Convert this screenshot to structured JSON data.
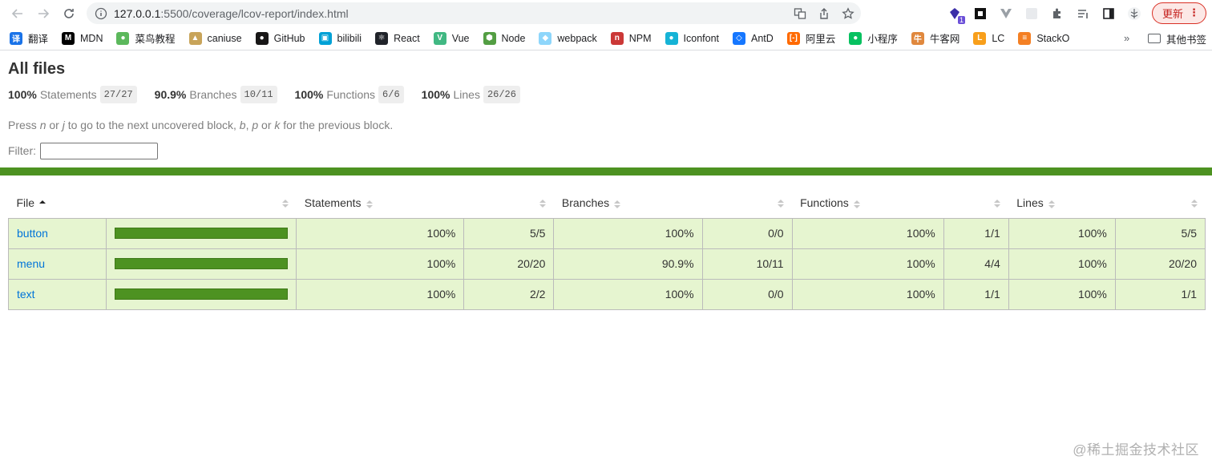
{
  "browser": {
    "url_host": "127.0.0.1",
    "url_rest": ":5500/coverage/lcov-report/index.html",
    "update_label": "更新",
    "extension_badge": "1",
    "bookmarks": [
      {
        "label": "翻译",
        "icon": "translate-icon",
        "color": "#1a73e8",
        "glyph": "译"
      },
      {
        "label": "MDN",
        "icon": "mdn-icon",
        "color": "#000000",
        "glyph": "M"
      },
      {
        "label": "菜鸟教程",
        "icon": "runoob-icon",
        "color": "#5cb85c",
        "glyph": "●"
      },
      {
        "label": "caniuse",
        "icon": "caniuse-icon",
        "color": "#c8a45a",
        "glyph": "▲"
      },
      {
        "label": "GitHub",
        "icon": "github-icon",
        "color": "#181717",
        "glyph": "●"
      },
      {
        "label": "bilibili",
        "icon": "bilibili-icon",
        "color": "#00a1d6",
        "glyph": "▣"
      },
      {
        "label": "React",
        "icon": "react-icon",
        "color": "#20232a",
        "glyph": "⚛"
      },
      {
        "label": "Vue",
        "icon": "vue-icon",
        "color": "#41b883",
        "glyph": "V"
      },
      {
        "label": "Node",
        "icon": "node-icon",
        "color": "#539e43",
        "glyph": "⬢"
      },
      {
        "label": "webpack",
        "icon": "webpack-icon",
        "color": "#8ed6fb",
        "glyph": "◆"
      },
      {
        "label": "NPM",
        "icon": "npm-icon",
        "color": "#cb3837",
        "glyph": "n"
      },
      {
        "label": "Iconfont",
        "icon": "iconfont-icon",
        "color": "#16b3d6",
        "glyph": "●"
      },
      {
        "label": "AntD",
        "icon": "antd-icon",
        "color": "#1677ff",
        "glyph": "◇"
      },
      {
        "label": "阿里云",
        "icon": "aliyun-icon",
        "color": "#ff6a00",
        "glyph": "[-]"
      },
      {
        "label": "小程序",
        "icon": "miniprogram-icon",
        "color": "#07c160",
        "glyph": "●"
      },
      {
        "label": "牛客网",
        "icon": "nowcoder-icon",
        "color": "#e0883e",
        "glyph": "牛"
      },
      {
        "label": "LC",
        "icon": "leetcode-icon",
        "color": "#f89f1b",
        "glyph": "L"
      },
      {
        "label": "StackO",
        "icon": "stackoverflow-icon",
        "color": "#f48024",
        "glyph": "≡"
      }
    ],
    "more_label": "»",
    "folder_label": "其他书签"
  },
  "report": {
    "title": "All files",
    "summary": [
      {
        "pct": "100%",
        "label": "Statements",
        "fraction": "27/27"
      },
      {
        "pct": "90.9%",
        "label": "Branches",
        "fraction": "10/11"
      },
      {
        "pct": "100%",
        "label": "Functions",
        "fraction": "6/6"
      },
      {
        "pct": "100%",
        "label": "Lines",
        "fraction": "26/26"
      }
    ],
    "help": {
      "p1": "Press ",
      "k1": "n",
      "p2": " or ",
      "k2": "j",
      "p3": " to go to the next uncovered block, ",
      "k3": "b",
      "p4": ", ",
      "k4": "p",
      "p5": " or ",
      "k5": "k",
      "p6": " for the previous block."
    },
    "filter_label": "Filter:",
    "filter_value": "",
    "columns": [
      "File",
      "",
      "Statements",
      "",
      "Branches",
      "",
      "Functions",
      "",
      "Lines",
      ""
    ],
    "rows": [
      {
        "file": "button",
        "coverage": 1.0,
        "stmt_pct": "100%",
        "stmt_frac": "5/5",
        "br_pct": "100%",
        "br_frac": "0/0",
        "fn_pct": "100%",
        "fn_frac": "1/1",
        "ln_pct": "100%",
        "ln_frac": "5/5"
      },
      {
        "file": "menu",
        "coverage": 1.0,
        "stmt_pct": "100%",
        "stmt_frac": "20/20",
        "br_pct": "90.9%",
        "br_frac": "10/11",
        "fn_pct": "100%",
        "fn_frac": "4/4",
        "ln_pct": "100%",
        "ln_frac": "20/20"
      },
      {
        "file": "text",
        "coverage": 1.0,
        "stmt_pct": "100%",
        "stmt_frac": "2/2",
        "br_pct": "100%",
        "br_frac": "0/0",
        "fn_pct": "100%",
        "fn_frac": "1/1",
        "ln_pct": "100%",
        "ln_frac": "1/1"
      }
    ],
    "colors": {
      "high": "#e6f5d0",
      "bar": "#4d9221",
      "link": "#0074d9"
    }
  },
  "watermark": "@稀土掘金技术社区"
}
